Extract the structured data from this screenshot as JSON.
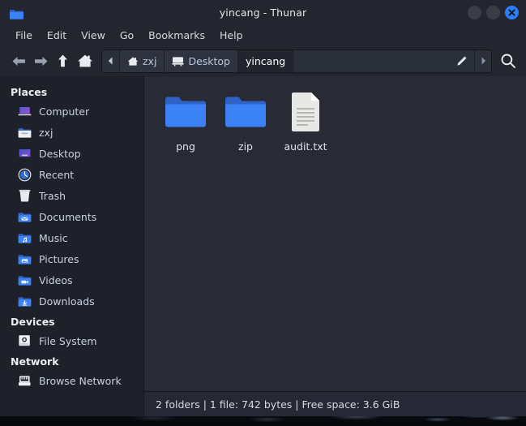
{
  "window": {
    "title": "yincang - Thunar",
    "app_icon": "folder-icon",
    "controls": {
      "minimize": "minimize-button",
      "maximize": "maximize-button",
      "close": "close-button"
    }
  },
  "menubar": {
    "items": [
      {
        "label": "File"
      },
      {
        "label": "Edit"
      },
      {
        "label": "View"
      },
      {
        "label": "Go"
      },
      {
        "label": "Bookmarks"
      },
      {
        "label": "Help"
      }
    ]
  },
  "toolbar": {
    "nav": [
      {
        "name": "back-button",
        "icon": "arrow-left-icon"
      },
      {
        "name": "forward-button",
        "icon": "arrow-right-icon"
      },
      {
        "name": "up-button",
        "icon": "arrow-up-icon"
      },
      {
        "name": "home-button",
        "icon": "home-icon"
      }
    ],
    "pathbar": {
      "scroll_left_icon": "chevron-left-icon",
      "scroll_right_icon": "chevron-right-icon",
      "edit_icon": "pencil-icon",
      "crumbs": [
        {
          "label": "zxj",
          "icon": "home-icon",
          "active": false
        },
        {
          "label": "Desktop",
          "icon": "desktop-icon",
          "active": false
        },
        {
          "label": "yincang",
          "icon": "",
          "active": true
        }
      ]
    },
    "search_icon": "search-icon"
  },
  "sidebar": {
    "sections": [
      {
        "title": "Places",
        "items": [
          {
            "label": "Computer",
            "icon": "computer-icon"
          },
          {
            "label": "zxj",
            "icon": "home-folder-icon"
          },
          {
            "label": "Desktop",
            "icon": "desktop-icon"
          },
          {
            "label": "Recent",
            "icon": "recent-clock-icon"
          },
          {
            "label": "Trash",
            "icon": "trash-icon"
          },
          {
            "label": "Documents",
            "icon": "documents-folder-icon"
          },
          {
            "label": "Music",
            "icon": "music-folder-icon"
          },
          {
            "label": "Pictures",
            "icon": "pictures-folder-icon"
          },
          {
            "label": "Videos",
            "icon": "videos-folder-icon"
          },
          {
            "label": "Downloads",
            "icon": "downloads-folder-icon"
          }
        ]
      },
      {
        "title": "Devices",
        "items": [
          {
            "label": "File System",
            "icon": "harddisk-icon"
          }
        ]
      },
      {
        "title": "Network",
        "items": [
          {
            "label": "Browse Network",
            "icon": "network-port-icon"
          }
        ]
      }
    ]
  },
  "files": [
    {
      "name": "png",
      "type": "folder",
      "icon": "folder-icon"
    },
    {
      "name": "zip",
      "type": "folder",
      "icon": "folder-icon"
    },
    {
      "name": "audit.txt",
      "type": "file",
      "icon": "text-document-icon"
    }
  ],
  "statusbar": {
    "text": "2 folders  |  1 file: 742 bytes  |  Free space: 3.6 GiB"
  },
  "colors": {
    "titlebar_bg": "#23262f",
    "sidebar_bg": "#1e202a",
    "content_bg": "#282b36",
    "statusbar_bg": "#262935",
    "accent_blue": "#2b7fff",
    "folder_blue": "#3b82f6",
    "text_primary": "#dfe3ea"
  }
}
